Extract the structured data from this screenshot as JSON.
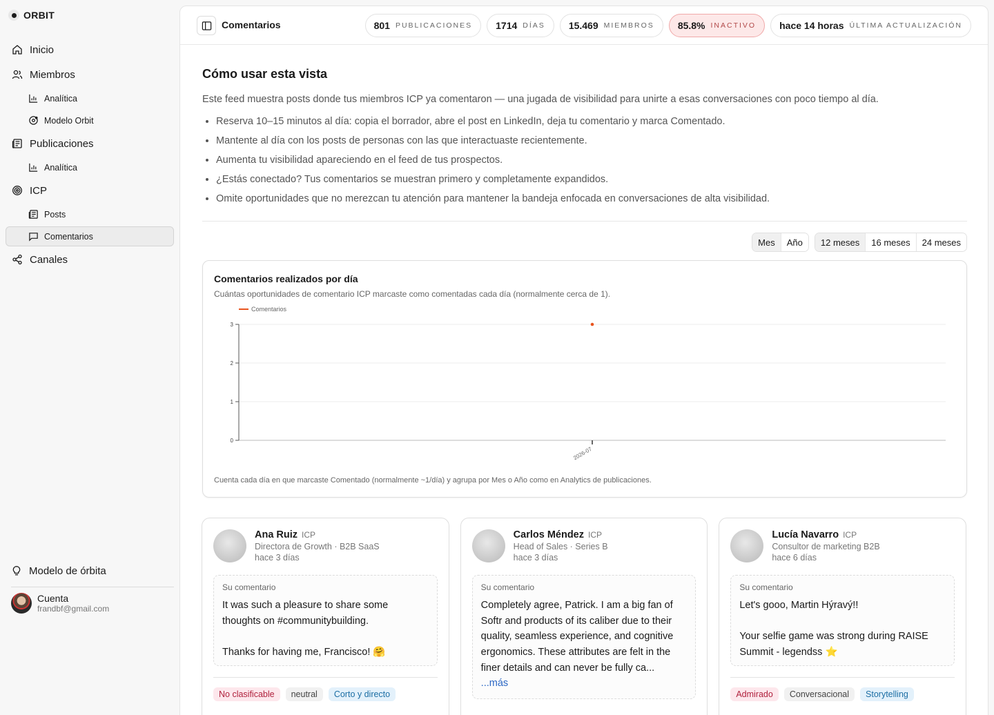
{
  "brand": "ORBIT",
  "nav": {
    "inicio": "Inicio",
    "miembros": "Miembros",
    "miembros_analitica": "Analítica",
    "modelo_orbit": "Modelo Orbit",
    "publicaciones": "Publicaciones",
    "publicaciones_analitica": "Analítica",
    "icp": "ICP",
    "posts": "Posts",
    "comentarios": "Comentarios",
    "canales": "Canales"
  },
  "sidebar_bottom": {
    "modelo": "Modelo de órbita",
    "account_name": "Cuenta",
    "account_email": "frandbf@gmail.com"
  },
  "topbar": {
    "title": "Comentarios",
    "stats": [
      {
        "value": "801",
        "label": "PUBLICACIONES"
      },
      {
        "value": "1714",
        "label": "DÍAS"
      },
      {
        "value": "15.469",
        "label": "MIEMBROS"
      },
      {
        "value": "85.8%",
        "label": "INACTIVO"
      },
      {
        "value": "hace 14 horas",
        "label": "ÚLTIMA ACTUALIZACIÓN"
      }
    ]
  },
  "howto": {
    "title": "Cómo usar esta vista",
    "description": "Este feed muestra posts donde tus miembros ICP ya comentaron — una jugada de visibilidad para unirte a esas conversaciones con poco tiempo al día.",
    "bullets": [
      "Reserva 10–15 minutos al día: copia el borrador, abre el post en LinkedIn, deja tu comentario y marca Comentado.",
      "Mantente al día con los posts de personas con las que interactuaste recientemente.",
      "Aumenta tu visibilidad apareciendo en el feed de tus prospectos.",
      "¿Estás conectado? Tus comentarios se muestran primero y completamente expandidos.",
      "Omite oportunidades que no merezcan tu atención para mantener la bandeja enfocada en conversaciones de alta visibilidad."
    ]
  },
  "controls": {
    "granularity": [
      "Mes",
      "Año"
    ],
    "ranges": [
      "12 meses",
      "16 meses",
      "24 meses"
    ]
  },
  "chart_data": {
    "type": "line",
    "title": "Comentarios realizados por día",
    "subtitle": "Cuántas oportunidades de comentario ICP marcaste como comentadas cada día (normalmente cerca de 1).",
    "footnote": "Cuenta cada día en que marcaste Comentado (normalmente ~1/día) y agrupa por Mes o Año como en Analytics de publicaciones.",
    "legend": "Comentarios",
    "legend_position": "top-left",
    "series_color": "#e8541e",
    "x": [
      "2026-07"
    ],
    "series": [
      {
        "name": "Comentarios",
        "values": [
          3
        ]
      }
    ],
    "ylim": [
      0,
      3
    ],
    "yticks": [
      0,
      1,
      2,
      3
    ],
    "grid": true
  },
  "cards": [
    {
      "name": "Ana Ruiz",
      "tag": "ICP",
      "role": "Directora de Growth · B2B SaaS",
      "time": "hace 3 días",
      "comment_label": "Su comentario",
      "comment": "It was such a pleasure to share some thoughts on #communitybuilding.\n\nThanks for having me, Francisco! 🤗",
      "more": "",
      "chips": [
        "No clasificable",
        "neutral",
        "Corto y directo"
      ]
    },
    {
      "name": "Carlos Méndez",
      "tag": "ICP",
      "role": "Head of Sales · Series B",
      "time": "hace 3 días",
      "comment_label": "Su comentario",
      "comment": "Completely agree, Patrick. I am a big fan of Softr and products of its caliber due to their quality, seamless experience, and cognitive ergonomics. These attributes are felt in the finer details and can never be fully ca...",
      "more": "...más",
      "chips": []
    },
    {
      "name": "Lucía Navarro",
      "tag": "ICP",
      "role": "Consultor de marketing B2B",
      "time": "hace 6 días",
      "comment_label": "Su comentario",
      "comment": "Let's gooo, Martin Hýravý!!\n\nYour selfie game was strong during RAISE Summit - legendss ⭐",
      "more": "",
      "chips": [
        "Admirado",
        "Conversacional",
        "Storytelling"
      ]
    }
  ]
}
